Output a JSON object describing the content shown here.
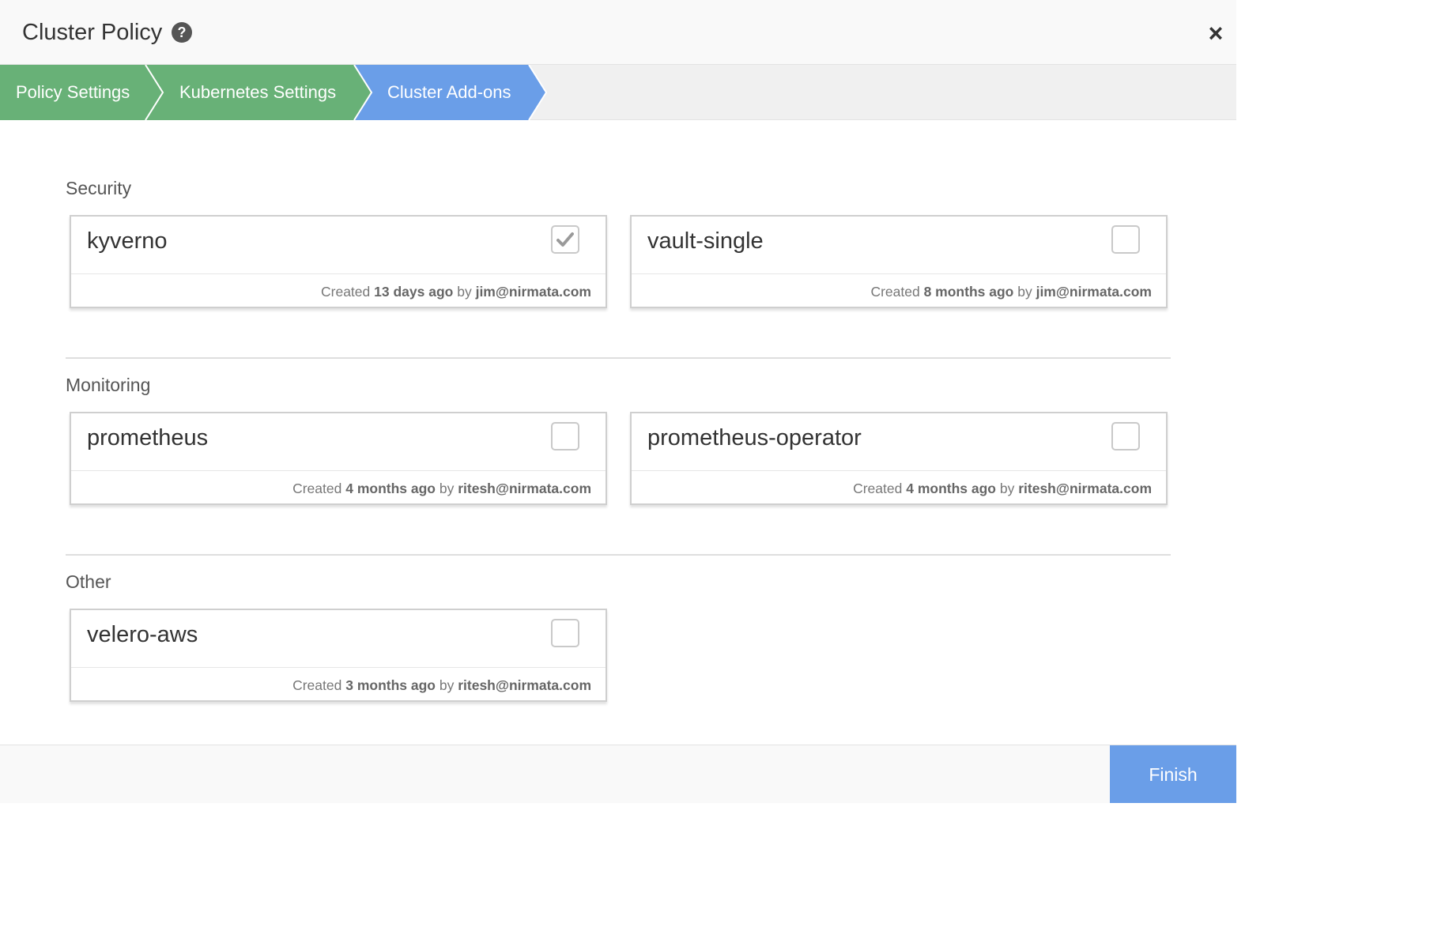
{
  "header": {
    "title": "Cluster Policy",
    "help_icon": "?",
    "close_icon": "×"
  },
  "wizard": {
    "steps": [
      {
        "label": "Policy Settings",
        "state": "complete"
      },
      {
        "label": "Kubernetes Settings",
        "state": "complete"
      },
      {
        "label": "Cluster Add-ons",
        "state": "active"
      }
    ],
    "colors": {
      "complete": "#68b177",
      "active": "#6a9ee8"
    }
  },
  "sections": [
    {
      "label": "Security",
      "addons": [
        {
          "name": "kyverno",
          "checked": true,
          "created_prefix": "Created",
          "age": "13 days ago",
          "by_text": "by",
          "author": "jim@nirmata.com"
        },
        {
          "name": "vault-single",
          "checked": false,
          "created_prefix": "Created",
          "age": "8 months ago",
          "by_text": "by",
          "author": "jim@nirmata.com"
        }
      ]
    },
    {
      "label": "Monitoring",
      "addons": [
        {
          "name": "prometheus",
          "checked": false,
          "created_prefix": "Created",
          "age": "4 months ago",
          "by_text": "by",
          "author": "ritesh@nirmata.com"
        },
        {
          "name": "prometheus-operator",
          "checked": false,
          "created_prefix": "Created",
          "age": "4 months ago",
          "by_text": "by",
          "author": "ritesh@nirmata.com"
        }
      ]
    },
    {
      "label": "Other",
      "addons": [
        {
          "name": "velero-aws",
          "checked": false,
          "created_prefix": "Created",
          "age": "3 months ago",
          "by_text": "by",
          "author": "ritesh@nirmata.com"
        }
      ]
    }
  ],
  "footer": {
    "finish_label": "Finish"
  }
}
